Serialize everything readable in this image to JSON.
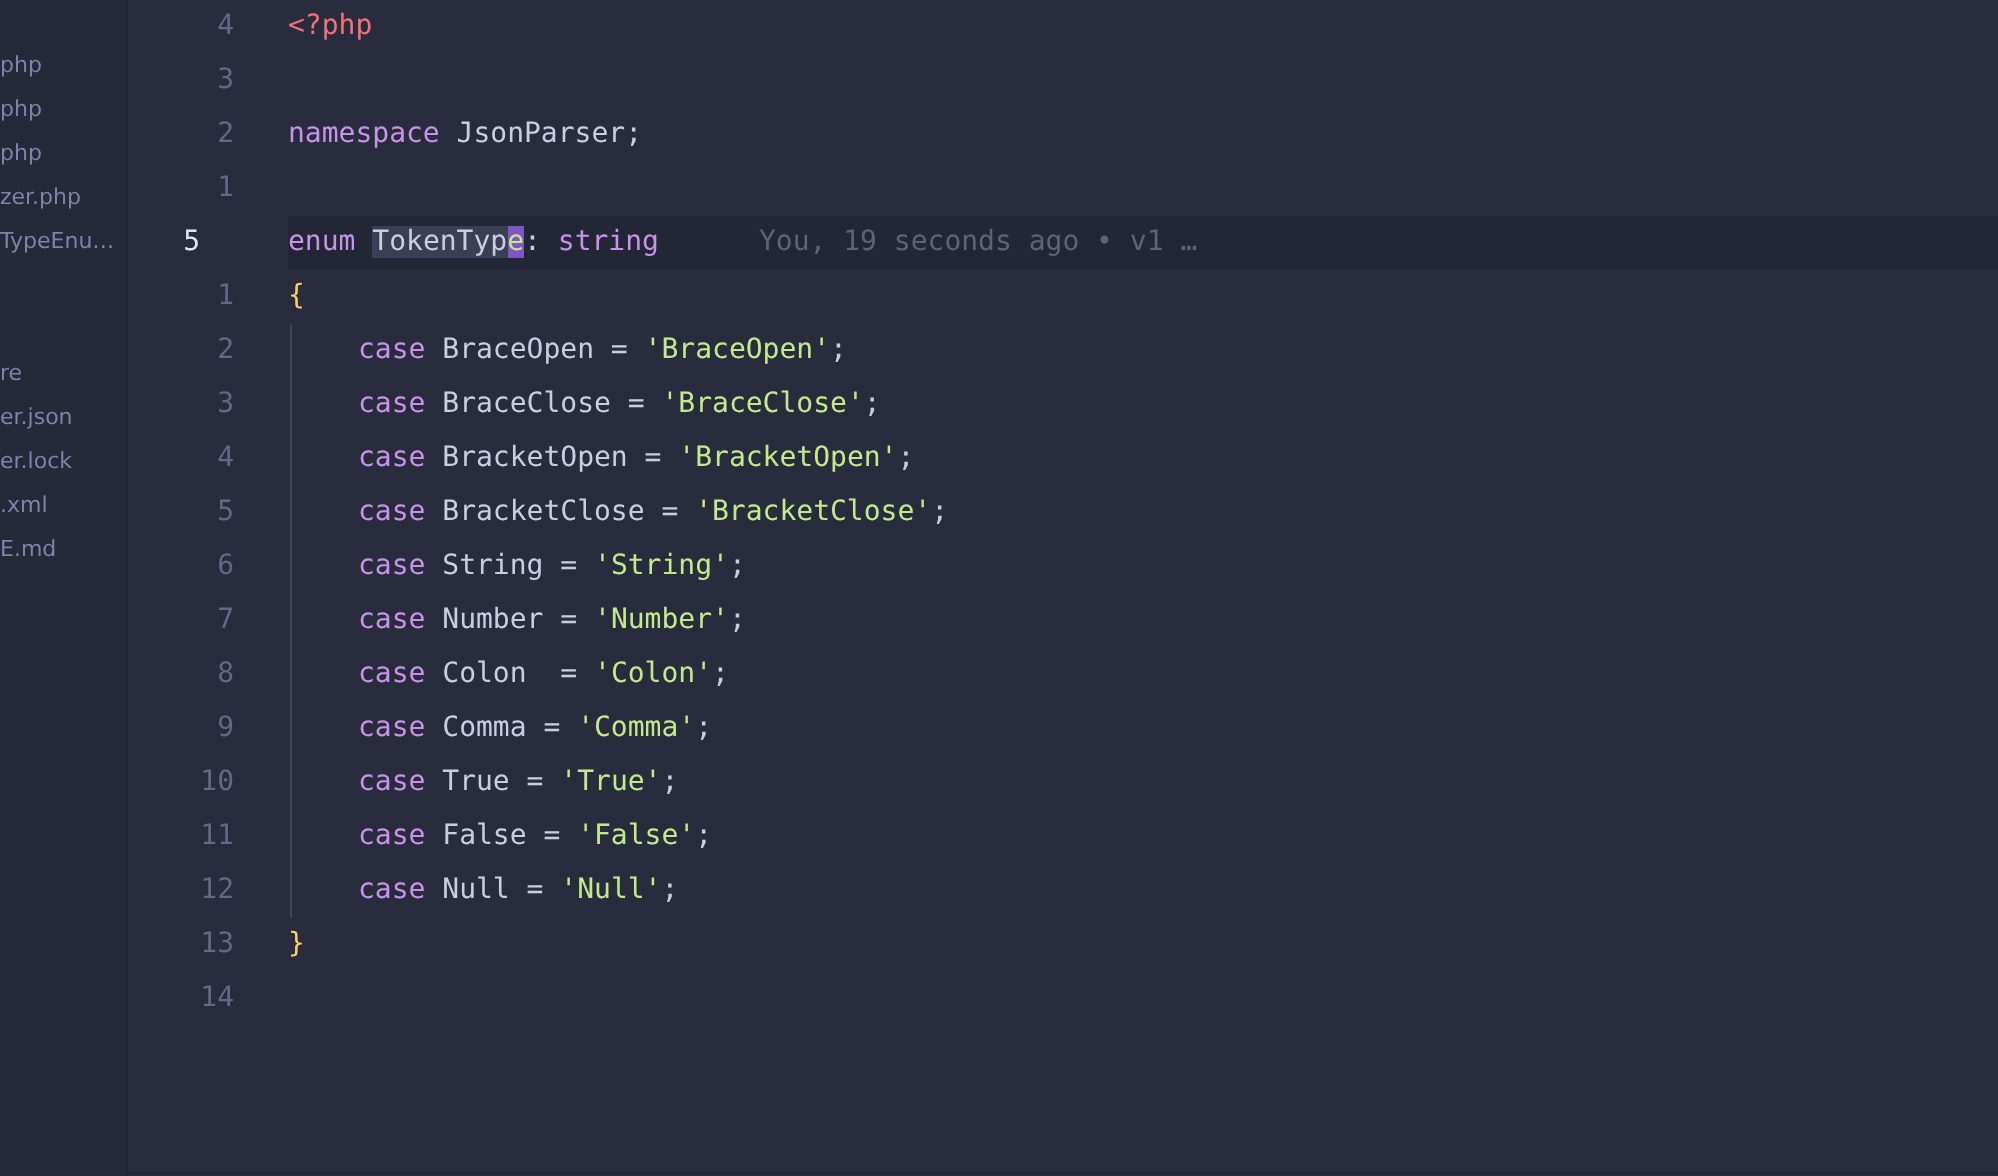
{
  "sidebar": {
    "groups": [
      {
        "items": [
          {
            "label": "php"
          },
          {
            "label": "php"
          },
          {
            "label": "php"
          },
          {
            "label": "zer.php"
          },
          {
            "label": "TypeEnu…"
          }
        ]
      },
      {
        "items": [
          {
            "label": "re"
          },
          {
            "label": "er.json"
          },
          {
            "label": "er.lock"
          },
          {
            "label": ".xml"
          },
          {
            "label": "E.md"
          }
        ]
      }
    ]
  },
  "editor": {
    "lines": [
      {
        "number": "4",
        "current": false,
        "indented": false,
        "tokens": [
          {
            "kind": "tag",
            "text": "<?php"
          }
        ]
      },
      {
        "number": "3",
        "current": false
      },
      {
        "number": "2",
        "current": false,
        "indented": false,
        "tokens": [
          {
            "kind": "keyword",
            "text": "namespace"
          },
          {
            "kind": "ident",
            "text": " JsonParser;"
          }
        ]
      },
      {
        "number": "1",
        "current": false
      },
      {
        "number": "5",
        "current": true,
        "indented": false,
        "blame": "You, 19 seconds ago • v1 …",
        "tokens": [
          {
            "kind": "keyword",
            "text": "enum "
          },
          {
            "kind": "selected",
            "text": "TokenTyp"
          },
          {
            "kind": "cursor",
            "text": "e"
          },
          {
            "kind": "ident",
            "text": ":"
          },
          {
            "kind": "keyword",
            "text": " string"
          }
        ]
      },
      {
        "number": "1",
        "current": false,
        "indented": false,
        "tokens": [
          {
            "kind": "brace",
            "text": "{"
          }
        ]
      },
      {
        "number": "2",
        "current": false,
        "indented": true,
        "tokens": [
          {
            "kind": "keyword",
            "text": "case"
          },
          {
            "kind": "ident",
            "text": " BraceOpen = "
          },
          {
            "kind": "string",
            "text": "'BraceOpen'"
          },
          {
            "kind": "ident",
            "text": ";"
          }
        ]
      },
      {
        "number": "3",
        "current": false,
        "indented": true,
        "tokens": [
          {
            "kind": "keyword",
            "text": "case"
          },
          {
            "kind": "ident",
            "text": " BraceClose = "
          },
          {
            "kind": "string",
            "text": "'BraceClose'"
          },
          {
            "kind": "ident",
            "text": ";"
          }
        ]
      },
      {
        "number": "4",
        "current": false,
        "indented": true,
        "tokens": [
          {
            "kind": "keyword",
            "text": "case"
          },
          {
            "kind": "ident",
            "text": " BracketOpen = "
          },
          {
            "kind": "string",
            "text": "'BracketOpen'"
          },
          {
            "kind": "ident",
            "text": ";"
          }
        ]
      },
      {
        "number": "5",
        "current": false,
        "indented": true,
        "tokens": [
          {
            "kind": "keyword",
            "text": "case"
          },
          {
            "kind": "ident",
            "text": " BracketClose = "
          },
          {
            "kind": "string",
            "text": "'BracketClose'"
          },
          {
            "kind": "ident",
            "text": ";"
          }
        ]
      },
      {
        "number": "6",
        "current": false,
        "indented": true,
        "tokens": [
          {
            "kind": "keyword",
            "text": "case"
          },
          {
            "kind": "ident",
            "text": " String = "
          },
          {
            "kind": "string",
            "text": "'String'"
          },
          {
            "kind": "ident",
            "text": ";"
          }
        ]
      },
      {
        "number": "7",
        "current": false,
        "indented": true,
        "tokens": [
          {
            "kind": "keyword",
            "text": "case"
          },
          {
            "kind": "ident",
            "text": " Number = "
          },
          {
            "kind": "string",
            "text": "'Number'"
          },
          {
            "kind": "ident",
            "text": ";"
          }
        ]
      },
      {
        "number": "8",
        "current": false,
        "indented": true,
        "tokens": [
          {
            "kind": "keyword",
            "text": "case"
          },
          {
            "kind": "ident",
            "text": " Colon  = "
          },
          {
            "kind": "string",
            "text": "'Colon'"
          },
          {
            "kind": "ident",
            "text": ";"
          }
        ]
      },
      {
        "number": "9",
        "current": false,
        "indented": true,
        "tokens": [
          {
            "kind": "keyword",
            "text": "case"
          },
          {
            "kind": "ident",
            "text": " Comma = "
          },
          {
            "kind": "string",
            "text": "'Comma'"
          },
          {
            "kind": "ident",
            "text": ";"
          }
        ]
      },
      {
        "number": "10",
        "current": false,
        "indented": true,
        "tokens": [
          {
            "kind": "keyword",
            "text": "case"
          },
          {
            "kind": "ident",
            "text": " True = "
          },
          {
            "kind": "string",
            "text": "'True'"
          },
          {
            "kind": "ident",
            "text": ";"
          }
        ]
      },
      {
        "number": "11",
        "current": false,
        "indented": true,
        "tokens": [
          {
            "kind": "keyword",
            "text": "case"
          },
          {
            "kind": "ident",
            "text": " False = "
          },
          {
            "kind": "string",
            "text": "'False'"
          },
          {
            "kind": "ident",
            "text": ";"
          }
        ]
      },
      {
        "number": "12",
        "current": false,
        "indented": true,
        "tokens": [
          {
            "kind": "keyword",
            "text": "case"
          },
          {
            "kind": "ident",
            "text": " Null = "
          },
          {
            "kind": "string",
            "text": "'Null'"
          },
          {
            "kind": "ident",
            "text": ";"
          }
        ]
      },
      {
        "number": "13",
        "current": false,
        "indented": false,
        "tokens": [
          {
            "kind": "brace",
            "text": "}"
          }
        ]
      },
      {
        "number": "14",
        "current": false
      }
    ]
  }
}
